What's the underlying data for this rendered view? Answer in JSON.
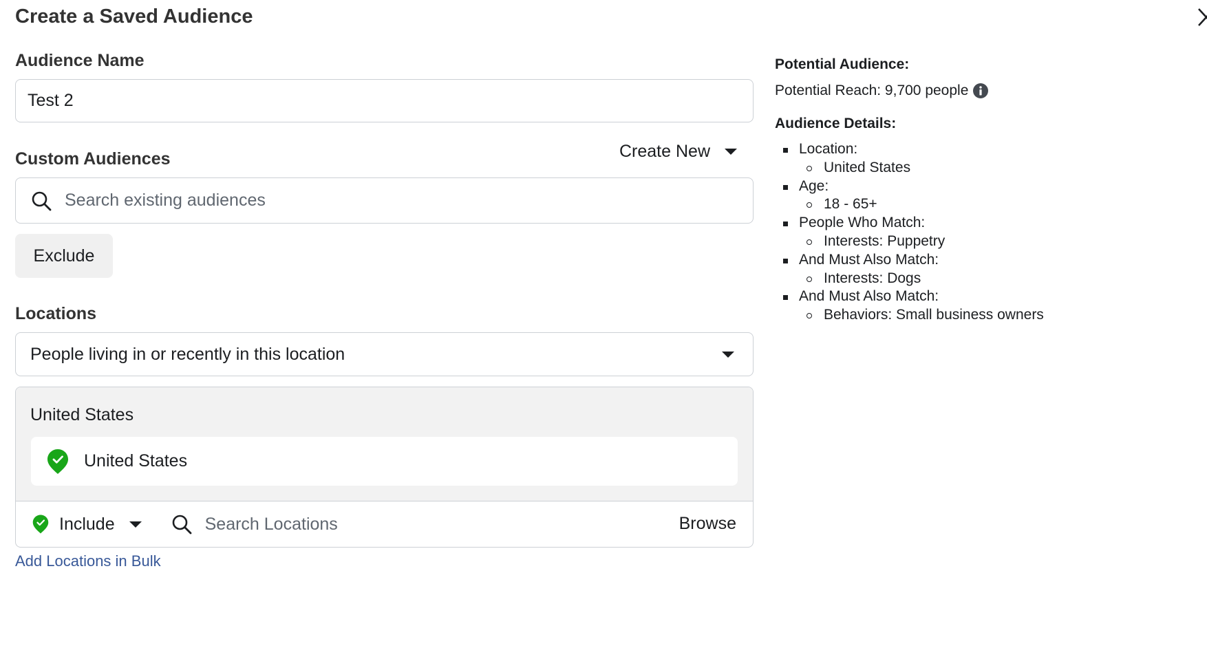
{
  "dialog": {
    "title": "Create a Saved Audience"
  },
  "audience_name": {
    "label": "Audience Name",
    "value": "Test 2"
  },
  "custom_audiences": {
    "label": "Custom Audiences",
    "create_new_label": "Create New",
    "search_placeholder": "Search existing audiences",
    "exclude_label": "Exclude"
  },
  "locations": {
    "label": "Locations",
    "selected_option": "People living in or recently in this location",
    "group_heading": "United States",
    "items": [
      {
        "name": "United States",
        "mode": "included"
      }
    ],
    "include_label": "Include",
    "search_placeholder": "Search Locations",
    "browse_label": "Browse",
    "bulk_link": "Add Locations in Bulk"
  },
  "summary": {
    "potential_audience_heading": "Potential Audience:",
    "potential_reach": "Potential Reach: 9,700 people",
    "details_heading": "Audience Details:",
    "details": [
      {
        "label": "Location:",
        "items": [
          "United States"
        ]
      },
      {
        "label": "Age:",
        "items": [
          "18 - 65+"
        ]
      },
      {
        "label": "People Who Match:",
        "items": [
          "Interests: Puppetry"
        ]
      },
      {
        "label": "And Must Also Match:",
        "items": [
          "Interests: Dogs"
        ]
      },
      {
        "label": "And Must Also Match:",
        "items": [
          "Behaviors: Small business owners"
        ]
      }
    ]
  },
  "icons": {
    "close": "close-icon",
    "search": "search-icon",
    "dropdown": "caret-down-icon",
    "location_pin": "location-pin-check-icon",
    "info": "info-icon"
  },
  "colors": {
    "pin_green": "#19a619",
    "link_blue": "#385898",
    "panel_gray": "#f2f2f2",
    "border": "#ccd0d5"
  }
}
